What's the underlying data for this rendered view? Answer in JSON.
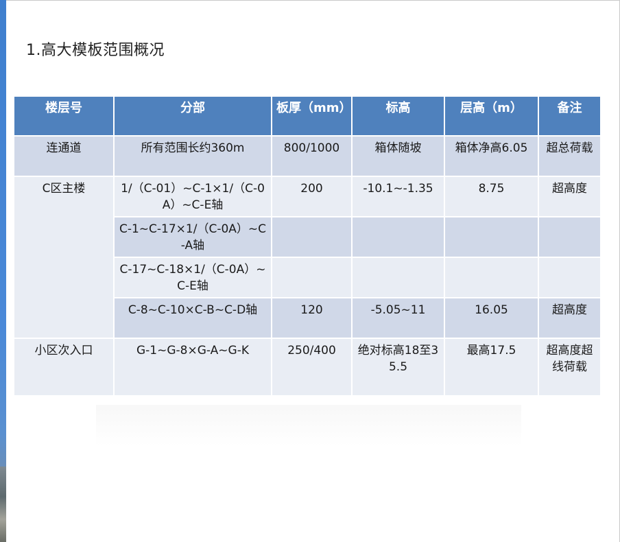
{
  "slide": {
    "title": "1.高大模板范围概况"
  },
  "table": {
    "headers": [
      "楼层号",
      "分部",
      "板厚（mm）",
      "标高",
      "层高（m）",
      "备注"
    ],
    "rows": [
      {
        "floor": "连通道",
        "part": "所有范围长约360m",
        "thickness": "800/1000",
        "elevation": "箱体随坡",
        "height": "箱体净高6.05",
        "note": "超总荷载"
      },
      {
        "floor": "C区主楼",
        "part": "1/（C-01）~C-1×1/（C-0A）~C-E轴",
        "thickness": "200",
        "elevation": "-10.1~-1.35",
        "height": "8.75",
        "note": "超高度"
      },
      {
        "floor": "",
        "part": "C-1~C-17×1/（C-0A）~C-A轴",
        "thickness": "",
        "elevation": "",
        "height": "",
        "note": ""
      },
      {
        "floor": "",
        "part": "C-17~C-18×1/（C-0A）~C-E轴",
        "thickness": "",
        "elevation": "",
        "height": "",
        "note": ""
      },
      {
        "floor": "",
        "part": "C-8~C-10×C-B~C-D轴",
        "thickness": "120",
        "elevation": "-5.05~11",
        "height": "16.05",
        "note": "超高度"
      },
      {
        "floor": "小区次入口",
        "part": "G-1~G-8×G-A~G-K",
        "thickness": "250/400",
        "elevation": "绝对标高18至35.5",
        "height": "最高17.5",
        "note": "超高度超线荷载"
      }
    ]
  }
}
